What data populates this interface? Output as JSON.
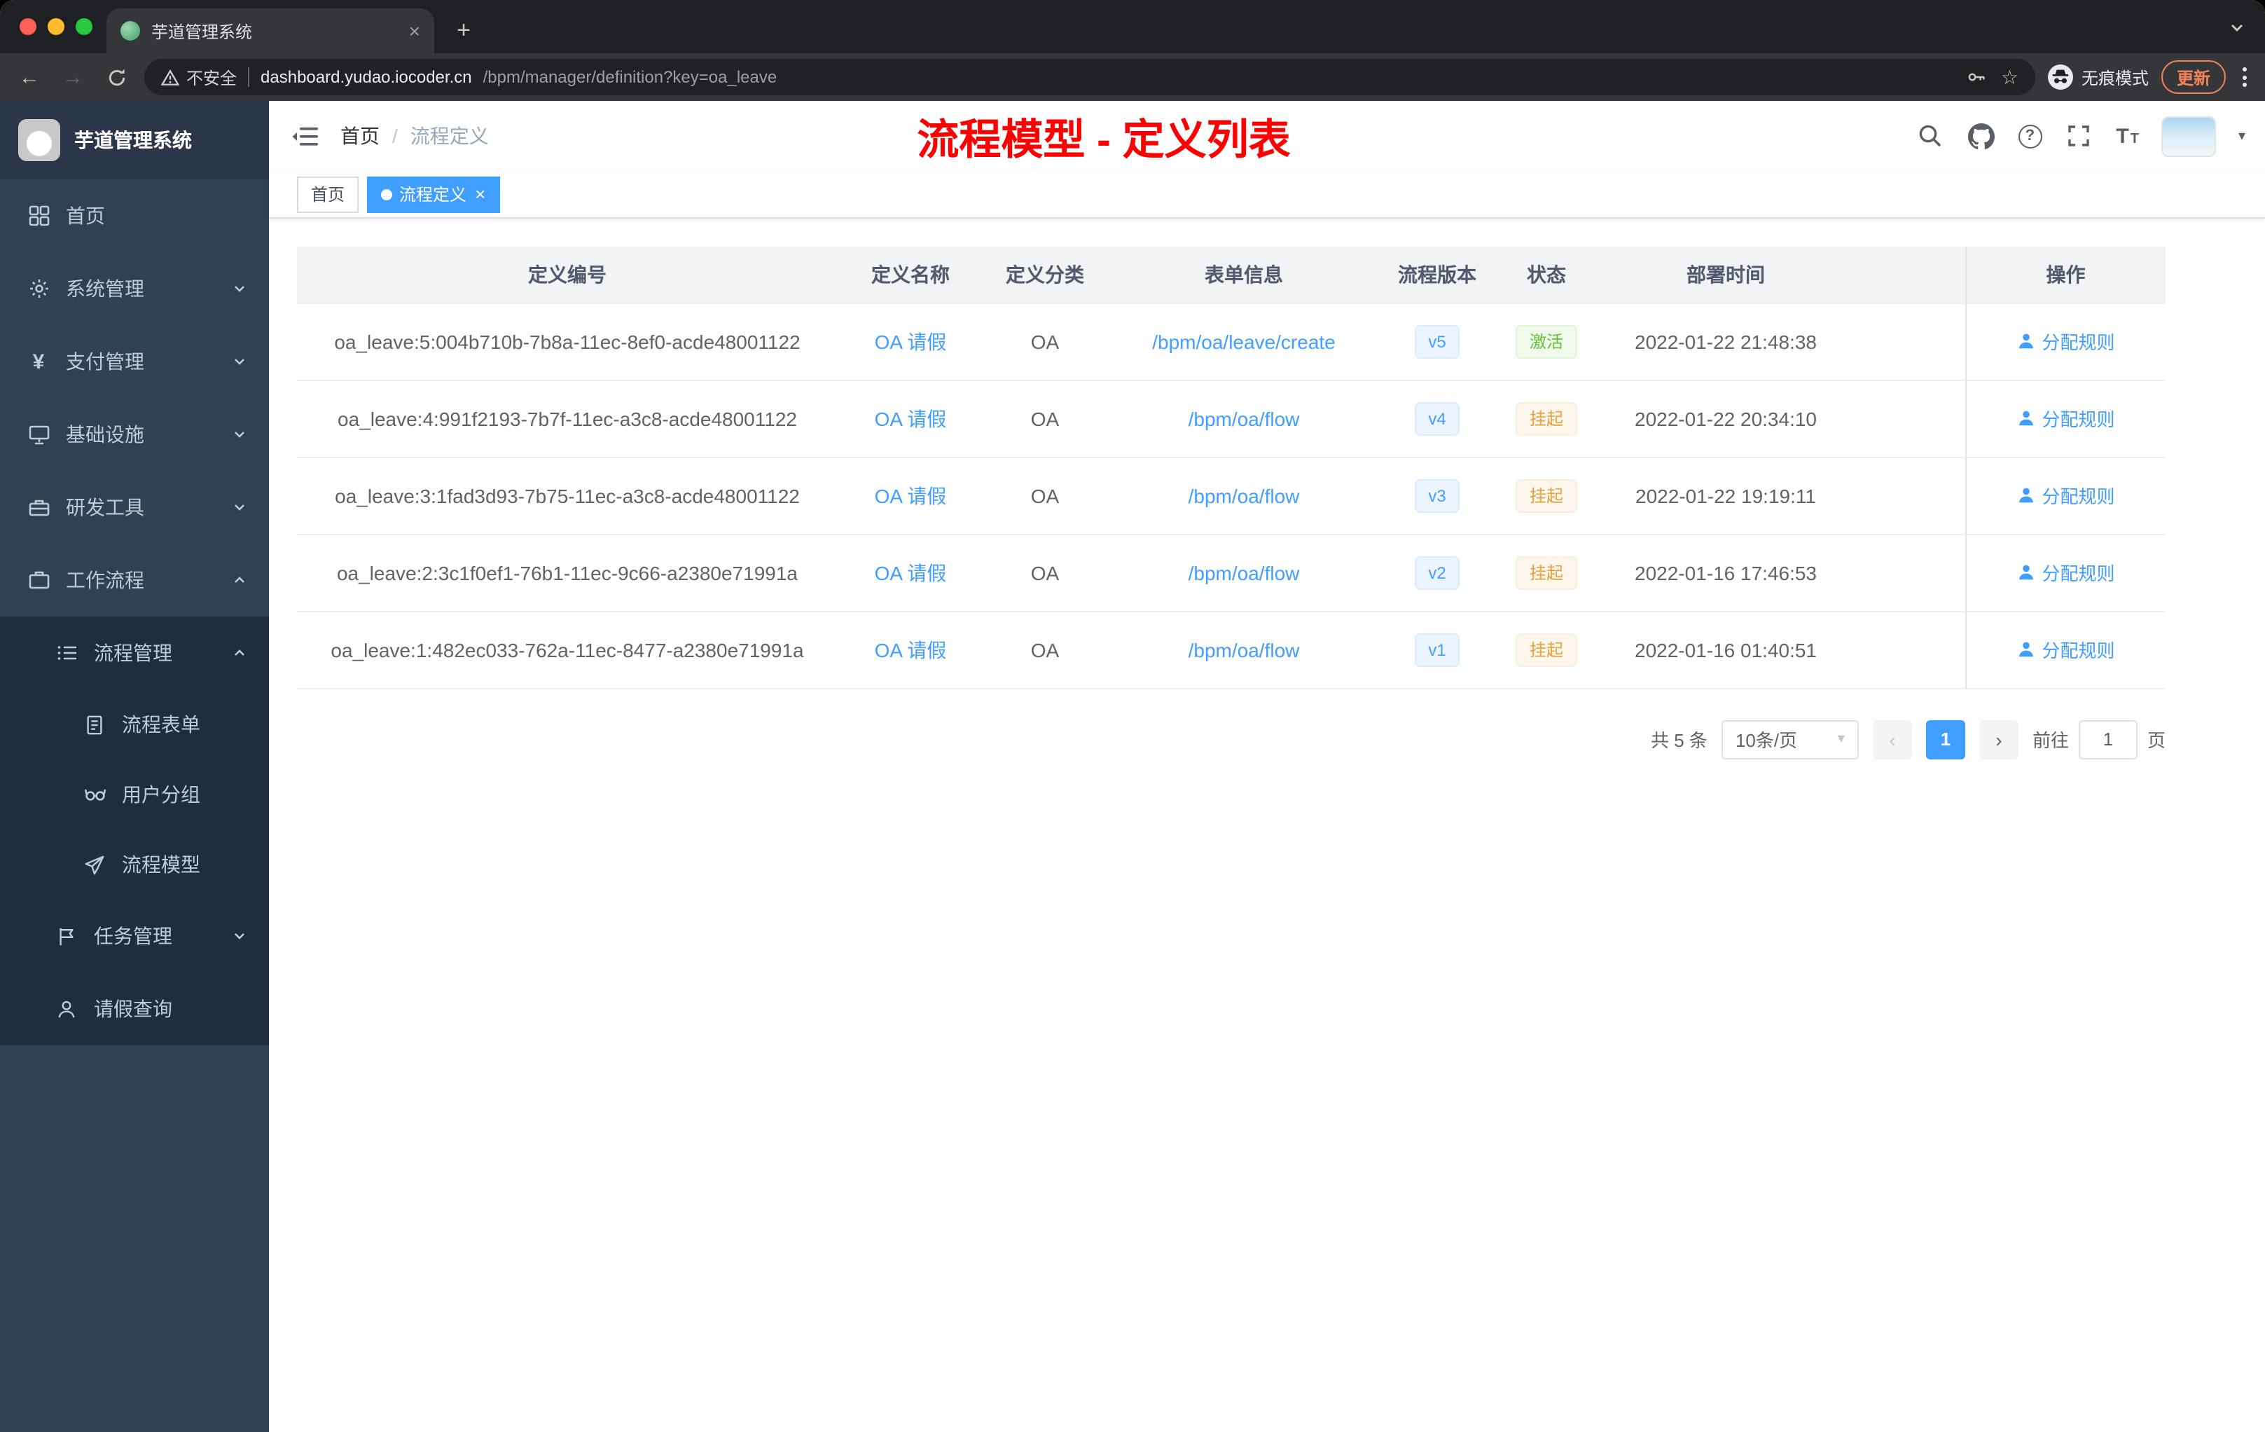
{
  "browser": {
    "tab_title": "芋道管理系统",
    "security_label": "不安全",
    "url_host": "dashboard.yudao.iocoder.cn",
    "url_path": "/bpm/manager/definition?key=oa_leave",
    "incognito_label": "无痕模式",
    "update_label": "更新"
  },
  "glyphs": {
    "back": "←",
    "forward": "→",
    "plus": "+",
    "close": "×",
    "star": "☆",
    "caret_down": "▾",
    "prev": "‹",
    "next": "›",
    "question": "?",
    "yen": "¥",
    "font_large": "T",
    "font_small": "T",
    "breadcrumb_sep": "/",
    "page_one": "1"
  },
  "sidebar": {
    "logo_title": "芋道管理系统",
    "menu": [
      "首页",
      "系统管理",
      "支付管理",
      "基础设施",
      "研发工具",
      "工作流程",
      "流程管理",
      "流程表单",
      "用户分组",
      "流程模型",
      "任务管理",
      "请假查询"
    ]
  },
  "header": {
    "breadcrumb_home": "首页",
    "breadcrumb_current": "流程定义",
    "annotation": "流程模型 - 定义列表"
  },
  "tags": {
    "home": "首页",
    "active": "流程定义"
  },
  "table": {
    "columns": [
      "定义编号",
      "定义名称",
      "定义分类",
      "表单信息",
      "流程版本",
      "状态",
      "部署时间",
      "操作"
    ],
    "rows": [
      {
        "id": "oa_leave:5:004b710b-7b8a-11ec-8ef0-acde48001122",
        "name": "OA 请假",
        "category": "OA",
        "form": "/bpm/oa/leave/create",
        "version": "v5",
        "status": "激活",
        "status_type": "success",
        "time": "2022-01-22 21:48:38",
        "action": "分配规则"
      },
      {
        "id": "oa_leave:4:991f2193-7b7f-11ec-a3c8-acde48001122",
        "name": "OA 请假",
        "category": "OA",
        "form": "/bpm/oa/flow",
        "version": "v4",
        "status": "挂起",
        "status_type": "warning",
        "time": "2022-01-22 20:34:10",
        "action": "分配规则"
      },
      {
        "id": "oa_leave:3:1fad3d93-7b75-11ec-a3c8-acde48001122",
        "name": "OA 请假",
        "category": "OA",
        "form": "/bpm/oa/flow",
        "version": "v3",
        "status": "挂起",
        "status_type": "warning",
        "time": "2022-01-22 19:19:11",
        "action": "分配规则"
      },
      {
        "id": "oa_leave:2:3c1f0ef1-76b1-11ec-9c66-a2380e71991a",
        "name": "OA 请假",
        "category": "OA",
        "form": "/bpm/oa/flow",
        "version": "v2",
        "status": "挂起",
        "status_type": "warning",
        "time": "2022-01-16 17:46:53",
        "action": "分配规则"
      },
      {
        "id": "oa_leave:1:482ec033-762a-11ec-8477-a2380e71991a",
        "name": "OA 请假",
        "category": "OA",
        "form": "/bpm/oa/flow",
        "version": "v1",
        "status": "挂起",
        "status_type": "warning",
        "time": "2022-01-16 01:40:51",
        "action": "分配规则"
      }
    ]
  },
  "pagination": {
    "total": "共 5 条",
    "page_size": "10条/页",
    "current_page": "1",
    "goto_label": "前往",
    "goto_value": "1",
    "page_unit": "页"
  },
  "icons": {
    "tab-favicon-icon": "green-app-glyph",
    "security-warning-icon": "triangle-exclamation",
    "reload-icon": "circular-arrow",
    "key-icon": "key",
    "star-icon": "star-outline",
    "incognito-icon": "spy-hat-glasses",
    "menu-dots-icon": "vertical-ellipsis",
    "hamburger-icon": "menu-fold-bars",
    "search-icon": "magnifier",
    "github-icon": "github-mark",
    "help-icon": "question-circle",
    "fullscreen-icon": "expand-corners",
    "font-size-icon": "double-T",
    "dashboard-icon": "grid",
    "gear-icon": "gear",
    "yen-icon": "yen-sign",
    "infrastructure-icon": "monitor",
    "devtools-icon": "toolbox",
    "workflow-icon": "briefcase",
    "process-list-icon": "bulleted-list",
    "form-icon": "document-lines",
    "user-group-icon": "glasses",
    "process-model-icon": "paper-plane",
    "task-icon": "flag",
    "person-icon": "person-silhouette",
    "assign-user-icon": "person-silhouette"
  },
  "colors": {
    "accent": "#409eff",
    "annotation_red": "#ff0000",
    "status_active": "#67c23a",
    "status_suspended": "#e6a23c",
    "sidebar_bg": "#304156",
    "submenu_bg": "#1f2d3d"
  }
}
